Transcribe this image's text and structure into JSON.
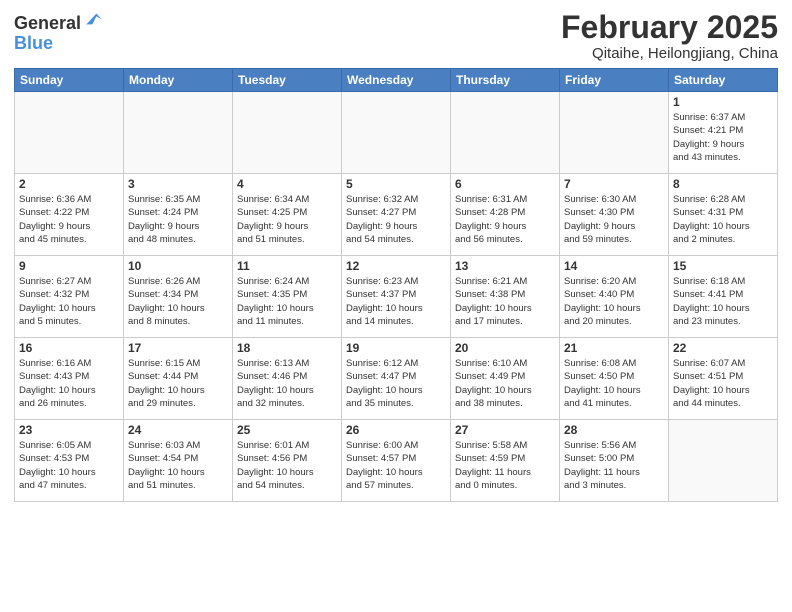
{
  "header": {
    "logo_line1": "General",
    "logo_line2": "Blue",
    "month": "February 2025",
    "location": "Qitaihe, Heilongjiang, China"
  },
  "weekdays": [
    "Sunday",
    "Monday",
    "Tuesday",
    "Wednesday",
    "Thursday",
    "Friday",
    "Saturday"
  ],
  "weeks": [
    [
      {
        "day": "",
        "info": ""
      },
      {
        "day": "",
        "info": ""
      },
      {
        "day": "",
        "info": ""
      },
      {
        "day": "",
        "info": ""
      },
      {
        "day": "",
        "info": ""
      },
      {
        "day": "",
        "info": ""
      },
      {
        "day": "1",
        "info": "Sunrise: 6:37 AM\nSunset: 4:21 PM\nDaylight: 9 hours\nand 43 minutes."
      }
    ],
    [
      {
        "day": "2",
        "info": "Sunrise: 6:36 AM\nSunset: 4:22 PM\nDaylight: 9 hours\nand 45 minutes."
      },
      {
        "day": "3",
        "info": "Sunrise: 6:35 AM\nSunset: 4:24 PM\nDaylight: 9 hours\nand 48 minutes."
      },
      {
        "day": "4",
        "info": "Sunrise: 6:34 AM\nSunset: 4:25 PM\nDaylight: 9 hours\nand 51 minutes."
      },
      {
        "day": "5",
        "info": "Sunrise: 6:32 AM\nSunset: 4:27 PM\nDaylight: 9 hours\nand 54 minutes."
      },
      {
        "day": "6",
        "info": "Sunrise: 6:31 AM\nSunset: 4:28 PM\nDaylight: 9 hours\nand 56 minutes."
      },
      {
        "day": "7",
        "info": "Sunrise: 6:30 AM\nSunset: 4:30 PM\nDaylight: 9 hours\nand 59 minutes."
      },
      {
        "day": "8",
        "info": "Sunrise: 6:28 AM\nSunset: 4:31 PM\nDaylight: 10 hours\nand 2 minutes."
      }
    ],
    [
      {
        "day": "9",
        "info": "Sunrise: 6:27 AM\nSunset: 4:32 PM\nDaylight: 10 hours\nand 5 minutes."
      },
      {
        "day": "10",
        "info": "Sunrise: 6:26 AM\nSunset: 4:34 PM\nDaylight: 10 hours\nand 8 minutes."
      },
      {
        "day": "11",
        "info": "Sunrise: 6:24 AM\nSunset: 4:35 PM\nDaylight: 10 hours\nand 11 minutes."
      },
      {
        "day": "12",
        "info": "Sunrise: 6:23 AM\nSunset: 4:37 PM\nDaylight: 10 hours\nand 14 minutes."
      },
      {
        "day": "13",
        "info": "Sunrise: 6:21 AM\nSunset: 4:38 PM\nDaylight: 10 hours\nand 17 minutes."
      },
      {
        "day": "14",
        "info": "Sunrise: 6:20 AM\nSunset: 4:40 PM\nDaylight: 10 hours\nand 20 minutes."
      },
      {
        "day": "15",
        "info": "Sunrise: 6:18 AM\nSunset: 4:41 PM\nDaylight: 10 hours\nand 23 minutes."
      }
    ],
    [
      {
        "day": "16",
        "info": "Sunrise: 6:16 AM\nSunset: 4:43 PM\nDaylight: 10 hours\nand 26 minutes."
      },
      {
        "day": "17",
        "info": "Sunrise: 6:15 AM\nSunset: 4:44 PM\nDaylight: 10 hours\nand 29 minutes."
      },
      {
        "day": "18",
        "info": "Sunrise: 6:13 AM\nSunset: 4:46 PM\nDaylight: 10 hours\nand 32 minutes."
      },
      {
        "day": "19",
        "info": "Sunrise: 6:12 AM\nSunset: 4:47 PM\nDaylight: 10 hours\nand 35 minutes."
      },
      {
        "day": "20",
        "info": "Sunrise: 6:10 AM\nSunset: 4:49 PM\nDaylight: 10 hours\nand 38 minutes."
      },
      {
        "day": "21",
        "info": "Sunrise: 6:08 AM\nSunset: 4:50 PM\nDaylight: 10 hours\nand 41 minutes."
      },
      {
        "day": "22",
        "info": "Sunrise: 6:07 AM\nSunset: 4:51 PM\nDaylight: 10 hours\nand 44 minutes."
      }
    ],
    [
      {
        "day": "23",
        "info": "Sunrise: 6:05 AM\nSunset: 4:53 PM\nDaylight: 10 hours\nand 47 minutes."
      },
      {
        "day": "24",
        "info": "Sunrise: 6:03 AM\nSunset: 4:54 PM\nDaylight: 10 hours\nand 51 minutes."
      },
      {
        "day": "25",
        "info": "Sunrise: 6:01 AM\nSunset: 4:56 PM\nDaylight: 10 hours\nand 54 minutes."
      },
      {
        "day": "26",
        "info": "Sunrise: 6:00 AM\nSunset: 4:57 PM\nDaylight: 10 hours\nand 57 minutes."
      },
      {
        "day": "27",
        "info": "Sunrise: 5:58 AM\nSunset: 4:59 PM\nDaylight: 11 hours\nand 0 minutes."
      },
      {
        "day": "28",
        "info": "Sunrise: 5:56 AM\nSunset: 5:00 PM\nDaylight: 11 hours\nand 3 minutes."
      },
      {
        "day": "",
        "info": ""
      }
    ]
  ]
}
